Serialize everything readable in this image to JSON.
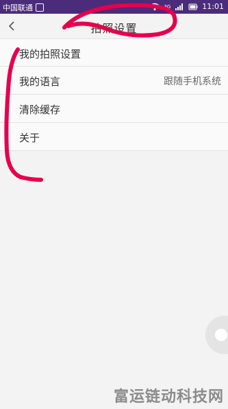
{
  "status_bar": {
    "carrier": "中国联通",
    "network": "3G",
    "time": "11:01"
  },
  "header": {
    "title": "拍照设置"
  },
  "settings": {
    "items": [
      {
        "label": "我的拍照设置",
        "value": ""
      },
      {
        "label": "我的语言",
        "value": "跟随手机系统"
      },
      {
        "label": "清除缓存",
        "value": ""
      },
      {
        "label": "关于",
        "value": ""
      }
    ]
  },
  "watermark": {
    "text": "富运链动科技网"
  },
  "colors": {
    "status_bar": "#4b2c7a",
    "annotation": "#e6004c",
    "background": "#f3f3f3"
  }
}
